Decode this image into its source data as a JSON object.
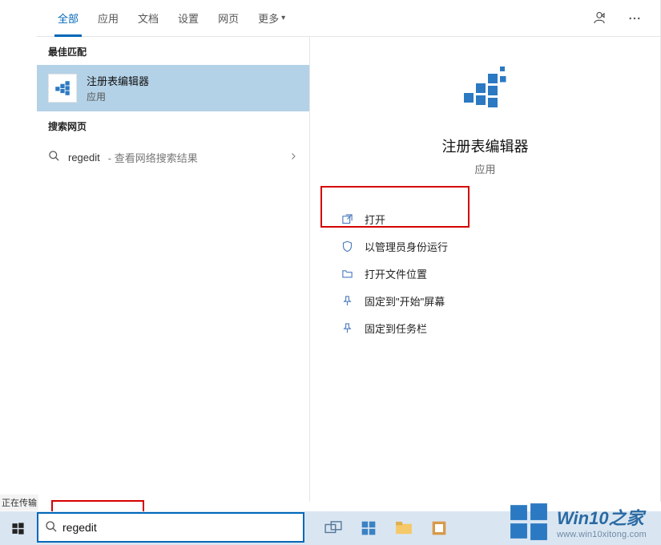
{
  "tabs": {
    "items": [
      "全部",
      "应用",
      "文档",
      "设置",
      "网页",
      "更多"
    ],
    "active_index": 0
  },
  "left_panel": {
    "best_match_header": "最佳匹配",
    "best_match": {
      "title": "注册表编辑器",
      "subtitle": "应用"
    },
    "web_header": "搜索网页",
    "web_item": {
      "query": "regedit",
      "hint": " - 查看网络搜索结果"
    }
  },
  "right_panel": {
    "app_title": "注册表编辑器",
    "app_sub": "应用",
    "actions": [
      "打开",
      "以管理员身份运行",
      "打开文件位置",
      "固定到\"开始\"屏幕",
      "固定到任务栏"
    ]
  },
  "taskbar": {
    "search_value": "regedit"
  },
  "status_text": "正在传输",
  "watermark": {
    "title_a": "Win10",
    "title_b": "之家",
    "url": "www.win10xitong.com"
  }
}
